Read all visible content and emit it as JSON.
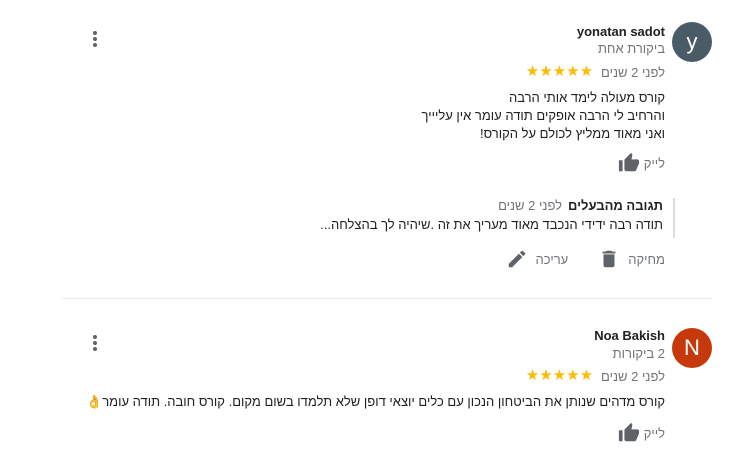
{
  "reviews": [
    {
      "avatar_letter": "y",
      "avatar_color": "#4a5b68",
      "name": "yonatan sadot",
      "review_count": "ביקורת אחת",
      "rating": 5,
      "time_ago": "לפני 2 שנים",
      "text": "קורס מעולה לימד אותי הרבה\nוהרחיב לי הרבה אופקים תודה עומר אין עליייך\nואני מאוד ממליץ לכולם על הקורס!",
      "like_label": "לייק",
      "owner_reply": {
        "title": "תגובה מהבעלים",
        "time_ago": "לפני 2 שנים",
        "text": "תודה רבה ידידי הנכבד מאוד מעריך את זה .שיהיה לך בהצלחה..."
      },
      "actions": {
        "edit_label": "עריכה",
        "delete_label": "מחיקה"
      }
    },
    {
      "avatar_letter": "N",
      "avatar_color": "#c5390c",
      "name": "Noa Bakish",
      "review_count": "2 ביקורות",
      "rating": 5,
      "time_ago": "לפני 2 שנים",
      "text": "קורס מדהים שנותן את הביטחון הנכון עם כלים יוצאי דופן שלא תלמדו בשום מקום. קורס חובה. תודה עומר👌",
      "like_label": "לייק"
    }
  ],
  "icons": {
    "more": "more-vert-icon",
    "star": "star-icon",
    "thumb": "thumb-up-icon",
    "edit": "pencil-icon",
    "delete": "trash-icon"
  }
}
